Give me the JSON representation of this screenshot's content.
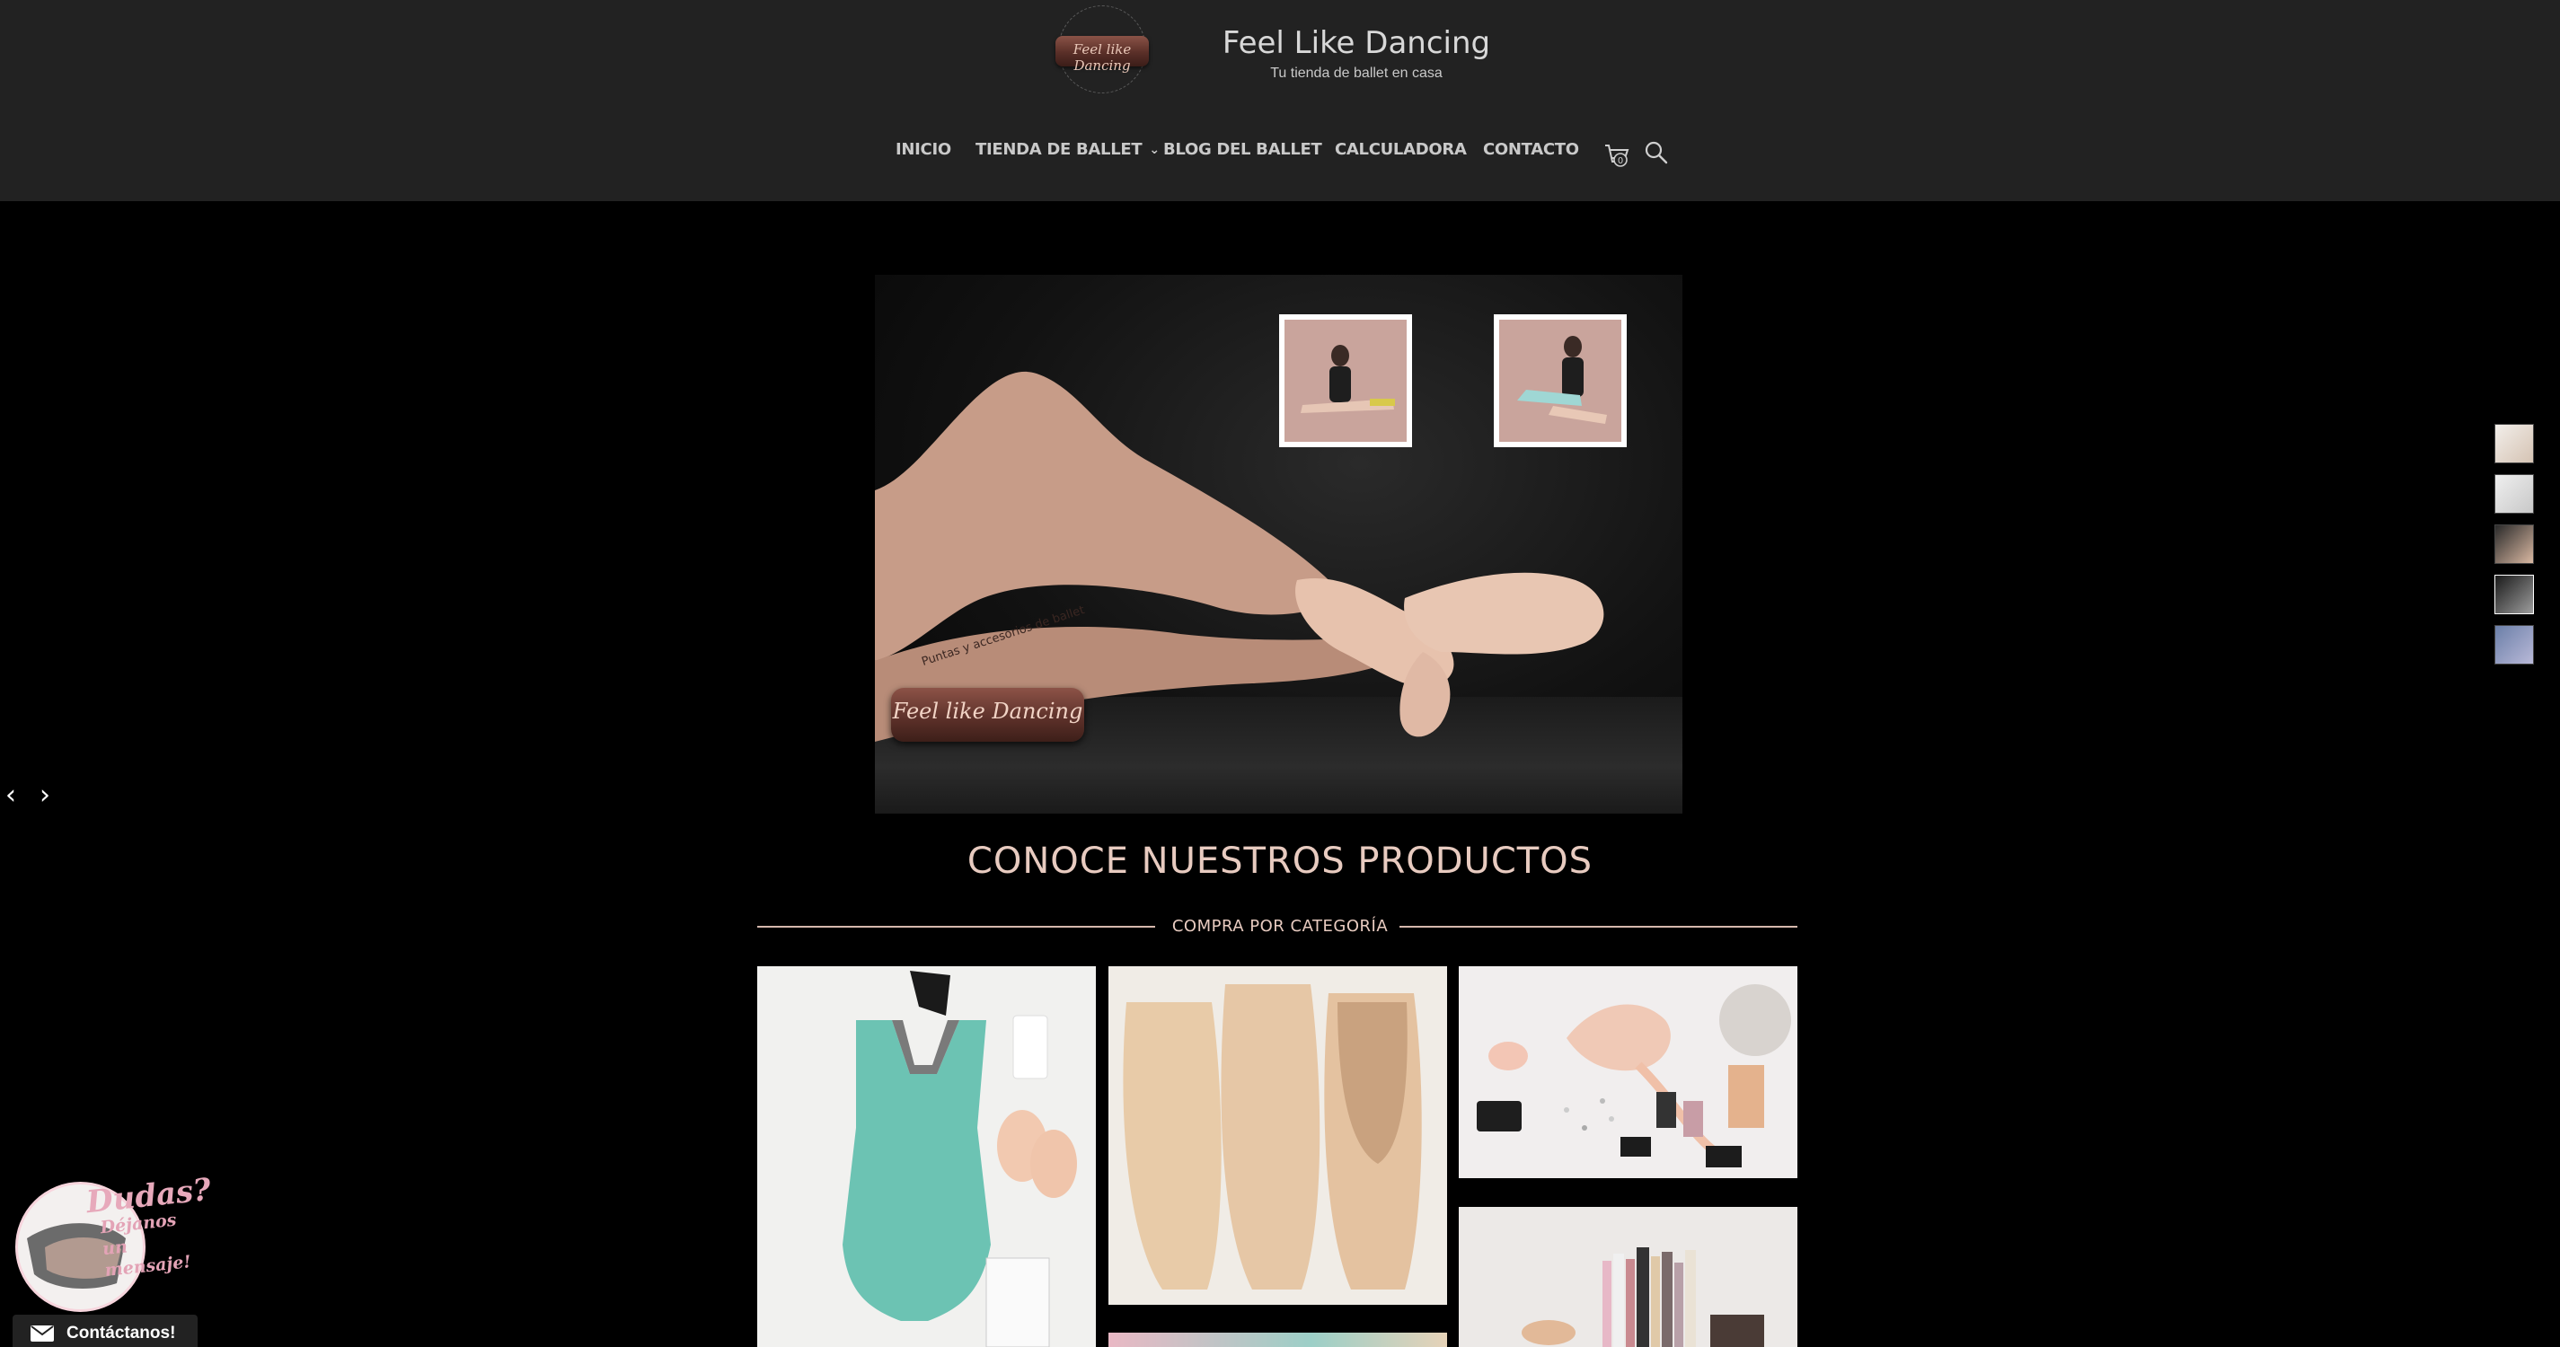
{
  "brand": {
    "logo_script": "Feel like Dancing",
    "title": "Feel Like Dancing",
    "subtitle": "Tu tienda de ballet en casa"
  },
  "nav": {
    "items": [
      {
        "label": "INICIO"
      },
      {
        "label": "TIENDA DE BALLET",
        "has_dropdown": true
      },
      {
        "label": "BLOG DEL BALLET"
      },
      {
        "label": "CALCULADORA"
      },
      {
        "label": "CONTACTO"
      }
    ],
    "cart_count": "0",
    "cart_icon": "cart-icon",
    "search_icon": "search-icon"
  },
  "hero": {
    "logo_text": "Feel like Dancing",
    "arc_text": "Puntas y accesorios de ballet",
    "prev_arrow": "‹",
    "next_arrow": "›"
  },
  "section": {
    "title": "CONOCE NUESTROS PRODUCTOS",
    "subtitle": "COMPRA POR CATEGORÍA"
  },
  "widget": {
    "dudas": "Dudas?",
    "message": "Déjanos un mensaje!",
    "contact_label": "Contáctanos!"
  },
  "colors": {
    "header_bg": "#222222",
    "page_bg": "#000000",
    "accent": "#e8cbc0",
    "nav_text": "#c9c9c9"
  }
}
